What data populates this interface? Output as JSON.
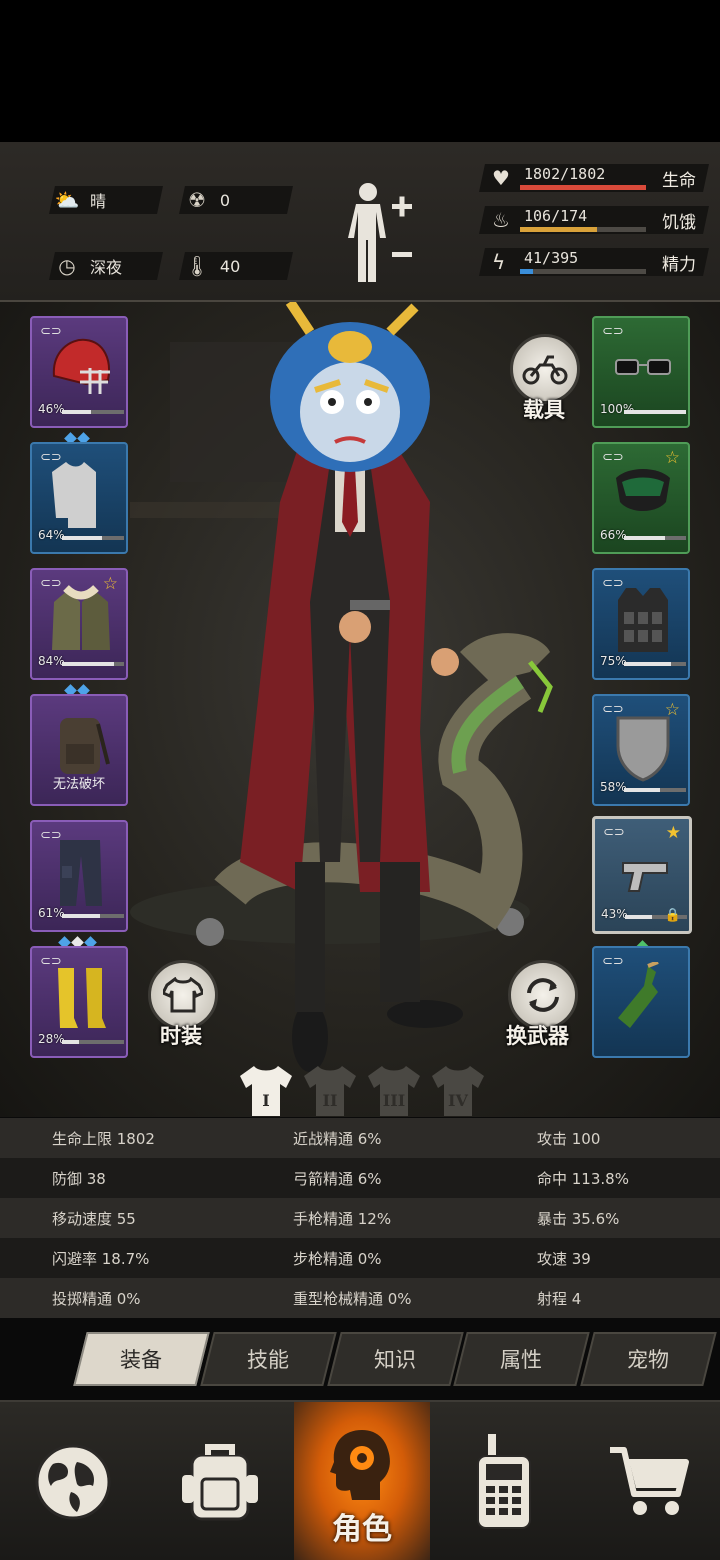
{
  "header": {
    "weather": "晴",
    "radiation": "0",
    "time_of_day": "深夜",
    "temperature": "40",
    "vitals": [
      {
        "label": "生命",
        "value": "1802/1802",
        "ratio": 1.0,
        "color": "#d94a3a",
        "icon": "heart-icon"
      },
      {
        "label": "饥饿",
        "value": "106/174",
        "ratio": 0.61,
        "color": "#d9a23a",
        "icon": "stomach-icon"
      },
      {
        "label": "精力",
        "value": "41/395",
        "ratio": 0.104,
        "color": "#3a8ed9",
        "icon": "energy-icon"
      }
    ]
  },
  "left_slots": [
    {
      "name": "helmet",
      "percent": "46%",
      "durability": 0.46,
      "gems": [
        "b",
        "b"
      ]
    },
    {
      "name": "shirt",
      "percent": "64%",
      "durability": 0.64,
      "gems": []
    },
    {
      "name": "jacket",
      "percent": "84%",
      "durability": 0.84,
      "gems": [
        "b",
        "b"
      ],
      "star": true
    },
    {
      "name": "backpack",
      "text": "无法破坏"
    },
    {
      "name": "pants",
      "percent": "61%",
      "durability": 0.61,
      "gems": [
        "b",
        "w",
        "b"
      ]
    },
    {
      "name": "boots",
      "percent": "28%",
      "durability": 0.28,
      "gems": []
    }
  ],
  "right_slots": [
    {
      "name": "glasses",
      "percent": "100%",
      "durability": 1.0
    },
    {
      "name": "mask",
      "percent": "66%",
      "durability": 0.66,
      "star": true
    },
    {
      "name": "vest",
      "percent": "75%",
      "durability": 0.75
    },
    {
      "name": "shield",
      "percent": "58%",
      "durability": 0.58,
      "star": true
    },
    {
      "name": "pistol",
      "percent": "43%",
      "durability": 0.43,
      "star": true,
      "locked": true
    },
    {
      "name": "molotov"
    }
  ],
  "buttons": {
    "vehicle": "载具",
    "fashion": "时装",
    "switch_weapon": "换武器"
  },
  "outfits": [
    "I",
    "II",
    "III",
    "IV"
  ],
  "stats": [
    [
      "生命上限 1802",
      "近战精通 6%",
      "攻击 100"
    ],
    [
      "防御 38",
      "弓箭精通 6%",
      "命中 113.8%"
    ],
    [
      "移动速度 55",
      "手枪精通 12%",
      "暴击 35.6%"
    ],
    [
      "闪避率 18.7%",
      "步枪精通 0%",
      "攻速 39"
    ],
    [
      "投掷精通 0%",
      "重型枪械精通 0%",
      "射程 4"
    ]
  ],
  "tabs": [
    "装备",
    "技能",
    "知识",
    "属性",
    "宠物"
  ],
  "nav": {
    "active_label": "角色"
  }
}
